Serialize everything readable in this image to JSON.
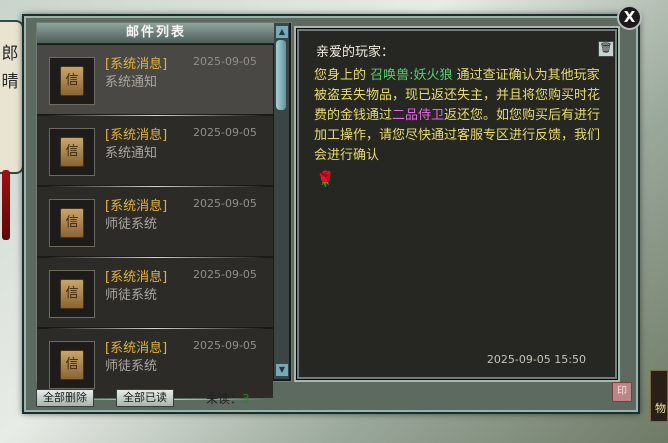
{
  "background": {
    "side_text": "郎 晴",
    "right_badge": "物"
  },
  "window": {
    "close_label": "X"
  },
  "mail_list": {
    "header": "邮件列表",
    "items": [
      {
        "title": "[系统消息]",
        "date": "2025-09-05",
        "subtitle": "系统通知",
        "selected": true
      },
      {
        "title": "[系统消息]",
        "date": "2025-09-05",
        "subtitle": "系统通知",
        "selected": false
      },
      {
        "title": "[系统消息]",
        "date": "2025-09-05",
        "subtitle": "师徒系统",
        "selected": false
      },
      {
        "title": "[系统消息]",
        "date": "2025-09-05",
        "subtitle": "师徒系统",
        "selected": false
      },
      {
        "title": "[系统消息]",
        "date": "2025-09-05",
        "subtitle": "师徒系统",
        "selected": false
      }
    ]
  },
  "actions": {
    "delete_all": "全部删除",
    "read_all": "全部已读",
    "unread_label": "未读：",
    "unread_count": "3"
  },
  "message": {
    "greeting": "亲爱的玩家：",
    "text_1": "您身上的 ",
    "item_name": "召唤兽:妖火狼",
    "text_2": " 通过查证确认为其他玩家被盗丢失物品，现已返还失主，并且将您购买时花费的金钱通过",
    "compensation": "二品侍卫",
    "text_3": "返还您。如您购买后有进行加工操作，请您尽快通过客服专区进行反馈，我们会进行确认",
    "date": "2025-09-05 15:50"
  },
  "colors": {
    "body_text": "#e9dd6a",
    "item_highlight": "#57d06d",
    "compensation_highlight": "#e66ae4",
    "mail_title": "#e3b23a",
    "unread_count": "#2e7f2e"
  },
  "icons": {
    "mail_icon_glyph": "信",
    "trash": "trash-icon",
    "rose": "rose-icon",
    "close": "close-icon"
  }
}
